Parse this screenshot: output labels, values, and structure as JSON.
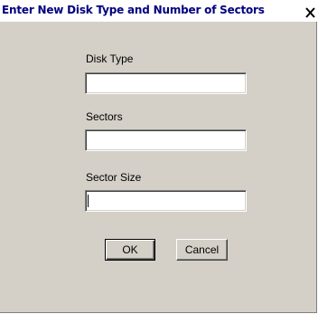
{
  "window": {
    "title": "Enter New Disk Type and Number of Sectors",
    "close_icon": "close-icon"
  },
  "fields": {
    "disk_type": {
      "label": "Disk Type",
      "value": ""
    },
    "sectors": {
      "label": "Sectors",
      "value": ""
    },
    "sector_size": {
      "label": "Sector Size",
      "value": ""
    }
  },
  "buttons": {
    "ok_label": "OK",
    "cancel_label": "Cancel"
  },
  "colors": {
    "dialog_background": "#d4d0c8",
    "title_text": "#000080"
  }
}
